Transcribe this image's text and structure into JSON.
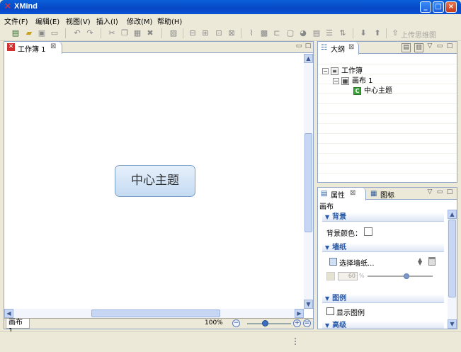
{
  "window": {
    "title": "XMind",
    "app_icon": "xmind-logo-icon",
    "minimize": "_",
    "maximize": "□",
    "close": "×"
  },
  "menu": {
    "items": [
      "文件(F)",
      "编辑(E)",
      "视图(V)",
      "插入(I)",
      "修改(M)",
      "帮助(H)"
    ]
  },
  "toolbar": {
    "upload_label": "上传思维图",
    "icons": [
      "new-icon",
      "open-icon",
      "save-icon",
      "print-icon",
      "undo-icon",
      "redo-icon",
      "cut-icon",
      "copy-icon",
      "paste-icon",
      "delete-icon",
      "format-painter-icon",
      "topic-icon",
      "subtopic-icon",
      "callout-icon",
      "floating-topic-icon",
      "attachment-icon",
      "image-icon",
      "relationship-icon",
      "boundary-icon",
      "summary-icon",
      "marker-icon",
      "label-icon",
      "notes-icon",
      "drill-down-icon",
      "drill-up-icon",
      "upload-icon"
    ]
  },
  "editor": {
    "tab_label": "工作簿 1",
    "tab_close": "⊠",
    "central_topic": "中心主题",
    "sheet_tab": "画布 1",
    "zoom": "100%"
  },
  "outline": {
    "tab_label": "大纲",
    "tab_close": "⊠",
    "tree": [
      {
        "label": "工作簿",
        "toggle": "−",
        "icon": "workbook-icon"
      },
      {
        "label": "画布 1",
        "toggle": "−",
        "icon": "sheet-icon"
      },
      {
        "label": "中心主题",
        "toggle": "",
        "icon": "C"
      }
    ]
  },
  "properties": {
    "tab_label": "属性",
    "tab_close": "⊠",
    "icons_tab_label": "图标",
    "subtitle": "画布",
    "sections": {
      "background": {
        "title": "背景",
        "color_label": "背景颜色："
      },
      "wallpaper": {
        "title": "墙纸",
        "select_label": "选择墙纸...",
        "opacity_value": "60",
        "opacity_unit": "%",
        "opacity_fraction": 0.6
      },
      "legend": {
        "title": "图例",
        "show_label": "显示图例"
      },
      "advanced": {
        "title": "高级"
      }
    }
  }
}
